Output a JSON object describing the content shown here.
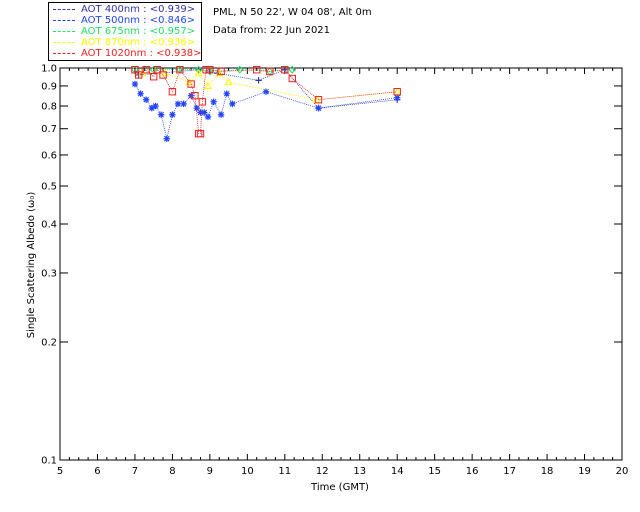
{
  "info": {
    "site_line": "PML, N 50 22', W 04 08', Alt 0m",
    "date_line": "Data from: 22 Jun 2021"
  },
  "legend": [
    {
      "text": "AOT  400nm : <0.939>",
      "color": "#3333aa"
    },
    {
      "text": "AOT  500nm : <0.846>",
      "color": "#2244ff"
    },
    {
      "text": "AOT  675nm : <0.957>",
      "color": "#22dd66"
    },
    {
      "text": "AOT  870nm : <0.936>",
      "color": "#ffff00"
    },
    {
      "text": "AOT 1020nm : <0.938>",
      "color": "#ee2222"
    }
  ],
  "chart_data": {
    "type": "scatter",
    "xlabel": "Time (GMT)",
    "ylabel": "Single Scattering Albedo (ω₀)",
    "xlim": [
      5,
      20
    ],
    "ylim": [
      0.1,
      1.0
    ],
    "yscale": "log",
    "xticks": [
      5,
      6,
      7,
      8,
      9,
      10,
      11,
      12,
      13,
      14,
      15,
      16,
      17,
      18,
      19,
      20
    ],
    "yticks": [
      0.1,
      0.2,
      0.3,
      0.4,
      0.5,
      0.6,
      0.7,
      0.8,
      0.9,
      1.0
    ],
    "ytick_labels": [
      "0.1",
      "0.2",
      "0.3",
      "0.4",
      "0.5",
      "0.6",
      "0.7",
      "0.8",
      "0.9",
      "1.0"
    ],
    "series": [
      {
        "name": "AOT  400nm",
        "color": "#3333aa",
        "marker": "plus",
        "x": [
          7.1,
          8.7,
          9.2,
          10.3,
          11.0,
          11.9,
          14.0
        ],
        "y": [
          0.96,
          0.99,
          0.97,
          0.93,
          0.99,
          0.79,
          0.83
        ]
      },
      {
        "name": "AOT  500nm",
        "color": "#2244ff",
        "marker": "star",
        "x": [
          7.0,
          7.15,
          7.3,
          7.45,
          7.55,
          7.7,
          7.85,
          8.0,
          8.15,
          8.3,
          8.5,
          8.65,
          8.75,
          8.85,
          8.95,
          9.1,
          9.3,
          9.45,
          9.6,
          10.5,
          11.9,
          14.0
        ],
        "y": [
          0.91,
          0.86,
          0.83,
          0.79,
          0.8,
          0.76,
          0.66,
          0.76,
          0.81,
          0.81,
          0.85,
          0.79,
          0.77,
          0.77,
          0.75,
          0.82,
          0.76,
          0.86,
          0.81,
          0.87,
          0.79,
          0.84
        ]
      },
      {
        "name": "AOT  675nm",
        "color": "#22dd66",
        "marker": "diamond",
        "x": [
          7.0,
          7.5,
          8.2,
          8.7,
          9.0,
          9.8,
          10.6,
          11.2
        ],
        "y": [
          0.99,
          0.99,
          0.99,
          0.99,
          0.98,
          0.99,
          0.98,
          0.99
        ]
      },
      {
        "name": "AOT  870nm",
        "color": "#ffff00",
        "marker": "triangle",
        "x": [
          7.2,
          7.8,
          8.45,
          8.7,
          8.95,
          9.25,
          9.5,
          11.85,
          14.0
        ],
        "y": [
          0.97,
          0.97,
          0.92,
          0.97,
          0.9,
          0.97,
          0.92,
          0.83,
          0.87
        ]
      },
      {
        "name": "AOT 1020nm",
        "color": "#ee2222",
        "marker": "square",
        "x": [
          7.0,
          7.1,
          7.3,
          7.5,
          7.6,
          7.75,
          8.0,
          8.2,
          8.5,
          8.6,
          8.7,
          8.75,
          8.8,
          8.9,
          9.0,
          9.3,
          10.25,
          10.6,
          11.0,
          11.2,
          11.9,
          14.0
        ],
        "y": [
          0.99,
          0.96,
          0.99,
          0.95,
          0.99,
          0.96,
          0.87,
          0.99,
          0.91,
          0.85,
          0.68,
          0.68,
          0.82,
          0.99,
          0.99,
          0.98,
          0.99,
          0.98,
          0.99,
          0.94,
          0.83,
          0.87
        ]
      }
    ]
  }
}
